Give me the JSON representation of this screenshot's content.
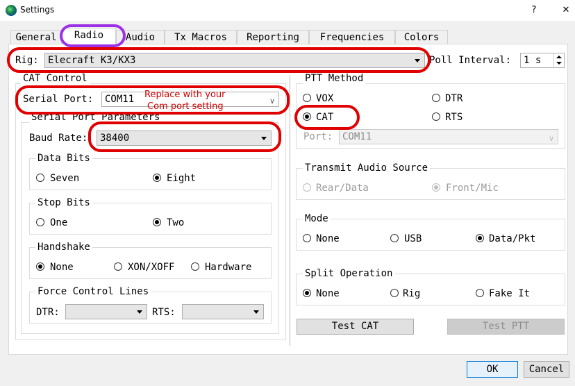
{
  "window": {
    "title": "Settings",
    "help": "?",
    "close": "✕"
  },
  "tabs": [
    "General",
    "Radio",
    "Audio",
    "Tx Macros",
    "Reporting",
    "Frequencies",
    "Colors"
  ],
  "rig": {
    "label": "Rig:",
    "value": "Elecraft K3/KX3",
    "poll_label": "Poll Interval:",
    "poll_value": "1 s"
  },
  "cat": {
    "title": "CAT Control",
    "serial_label": "Serial Port:",
    "serial_value": "COM11",
    "params_title": "Serial Port Parameters",
    "baud_label": "Baud Rate:",
    "baud_value": "38400",
    "data_bits": {
      "title": "Data Bits",
      "seven": "Seven",
      "eight": "Eight"
    },
    "stop_bits": {
      "title": "Stop Bits",
      "one": "One",
      "two": "Two"
    },
    "handshake": {
      "title": "Handshake",
      "none": "None",
      "xon": "XON/XOFF",
      "hardware": "Hardware"
    },
    "force": {
      "title": "Force Control Lines",
      "dtr": "DTR:",
      "rts": "RTS:"
    }
  },
  "ptt": {
    "title": "PTT Method",
    "vox": "VOX",
    "dtr": "DTR",
    "cat": "CAT",
    "rts": "RTS",
    "port_label": "Port:",
    "port_value": "COM11"
  },
  "tx_audio": {
    "title": "Transmit Audio Source",
    "rear": "Rear/Data",
    "front": "Front/Mic"
  },
  "mode": {
    "title": "Mode",
    "none": "None",
    "usb": "USB",
    "data": "Data/Pkt"
  },
  "split": {
    "title": "Split Operation",
    "none": "None",
    "rig": "Rig",
    "fake": "Fake It"
  },
  "buttons": {
    "test_cat": "Test CAT",
    "test_ptt": "Test PTT",
    "ok": "OK",
    "cancel": "Cancel"
  },
  "annotation": {
    "line1": "Replace with your",
    "line2": "Com port setting"
  },
  "colors": {
    "annotation_red": "#e00000",
    "annotation_purple": "#9b30e6"
  }
}
